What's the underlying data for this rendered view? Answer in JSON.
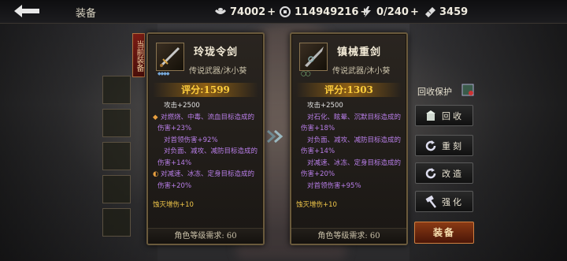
{
  "topbar": {
    "title": "装备",
    "back_icon": "back-arrow-icon",
    "resources": [
      {
        "icon": "ingot-icon",
        "value": "74002"
      },
      {
        "icon": "coin-icon",
        "value": "114949216"
      },
      {
        "icon": "lightning-icon",
        "value": "0/240"
      },
      {
        "icon": "ticket-icon",
        "value": "3459"
      }
    ],
    "plus": "+"
  },
  "side_tab": {
    "label": "当前装备"
  },
  "left_card": {
    "name": "玲珑令剑",
    "type": "传说武器/沐小葵",
    "score": "评分:1599",
    "stats": [
      {
        "text": "攻击+2500",
        "kind": "base"
      },
      {
        "text": "对燃烧、中毒、流血目标造成的",
        "kind": "purple",
        "bullet": "◆"
      },
      {
        "text": "伤害+23%",
        "kind": "purple-deep"
      },
      {
        "text": "对首领伤害+92%",
        "kind": "purple-indent"
      },
      {
        "text": "对负面、减攻、减防目标造成的",
        "kind": "purple-indent"
      },
      {
        "text": "伤害+14%",
        "kind": "purple-deep"
      },
      {
        "text": "对减速、冰冻、定身目标造成的",
        "kind": "purple",
        "bullet": "◐"
      },
      {
        "text": "伤害+20%",
        "kind": "purple-deep"
      },
      {
        "text": "",
        "kind": "spacer"
      },
      {
        "text": "蚀灭增伤+10",
        "kind": "gold"
      }
    ],
    "requirement": "角色等级需求: 60"
  },
  "right_card": {
    "name": "镇械重剑",
    "type": "传说武器/沐小葵",
    "score": "评分:1303",
    "stats": [
      {
        "text": "攻击+2500",
        "kind": "base"
      },
      {
        "text": "对石化、眩晕、沉默目标造成的",
        "kind": "purple-indent"
      },
      {
        "text": "伤害+18%",
        "kind": "purple-deep"
      },
      {
        "text": "对负面、减攻、减防目标造成的",
        "kind": "purple-indent"
      },
      {
        "text": "伤害+14%",
        "kind": "purple-deep"
      },
      {
        "text": "对减速、冰冻、定身目标造成的",
        "kind": "purple-indent"
      },
      {
        "text": "伤害+20%",
        "kind": "purple-deep"
      },
      {
        "text": "对首领伤害+95%",
        "kind": "purple-indent"
      },
      {
        "text": "",
        "kind": "spacer"
      },
      {
        "text": "蚀灭增伤+10",
        "kind": "gold"
      }
    ],
    "requirement": "角色等级需求: 60"
  },
  "right_panel": {
    "recycle_protect": "回收保护",
    "buttons": [
      {
        "label": "回收",
        "icon": "recycle-icon"
      },
      {
        "label": "重刻",
        "icon": "reroll-icon"
      },
      {
        "label": "改造",
        "icon": "modify-icon"
      },
      {
        "label": "强化",
        "icon": "hammer-icon"
      }
    ],
    "equip": "装备"
  }
}
